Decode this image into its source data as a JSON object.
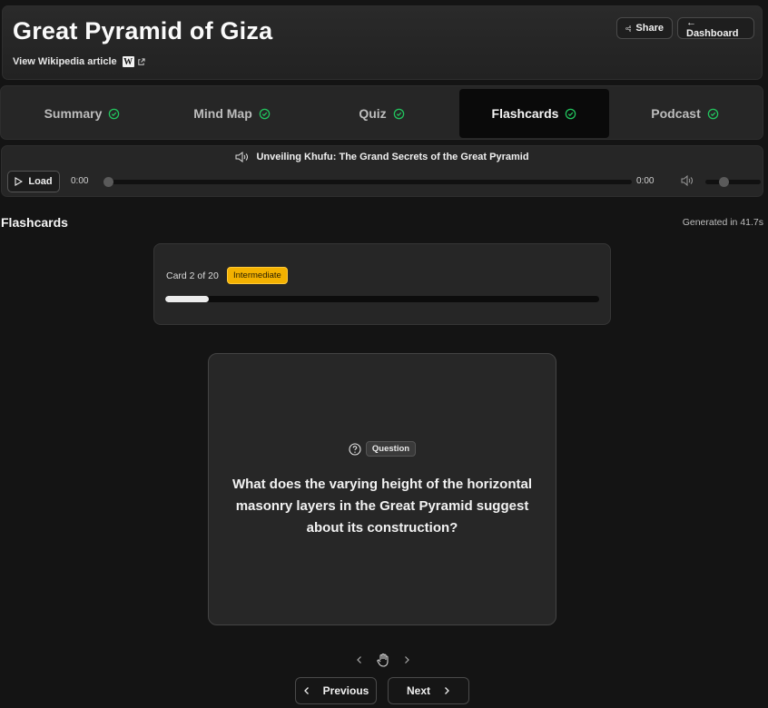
{
  "header": {
    "title": "Great Pyramid of Giza",
    "wiki_link": "View Wikipedia article",
    "wiki_badge": "W",
    "share_label": "Share",
    "dashboard_label": "← Dashboard"
  },
  "tabs": [
    {
      "label": "Summary",
      "done": true,
      "active": false
    },
    {
      "label": "Mind Map",
      "done": true,
      "active": false
    },
    {
      "label": "Quiz",
      "done": true,
      "active": false
    },
    {
      "label": "Flashcards",
      "done": true,
      "active": true
    },
    {
      "label": "Podcast",
      "done": true,
      "active": false
    }
  ],
  "player": {
    "episode_title": "Unveiling Khufu: The Grand Secrets of the Great Pyramid",
    "load_label": "Load",
    "current_time": "0:00",
    "duration": "0:00",
    "progress": 0,
    "volume": 0.3
  },
  "flashcards": {
    "section_title": "Flashcards",
    "generated": "Generated in 41.7s",
    "card_counter": "Card 2 of 20",
    "difficulty": "Intermediate",
    "progress_fraction": 0.1,
    "card_type": "Question",
    "question": "What does the varying height of the horizontal masonry layers in the Great Pyramid suggest about its construction?",
    "prev_label": "Previous",
    "next_label": "Next"
  },
  "colors": {
    "background": "#141414",
    "panel": "#262626",
    "accent_check": "#22c55e",
    "difficulty_badge": "#f3b100"
  }
}
